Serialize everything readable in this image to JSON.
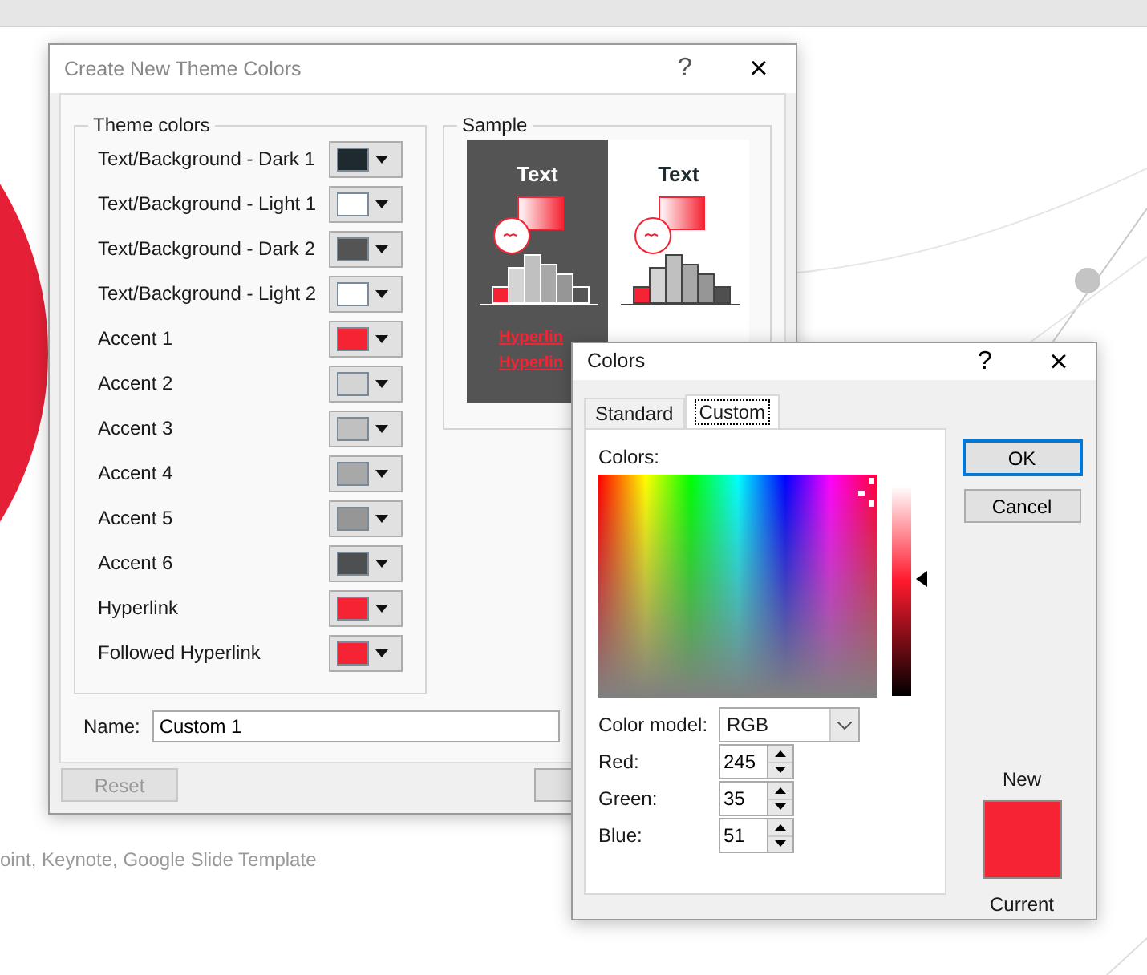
{
  "slide": {
    "subtitle": "oint, Keynote, Google Slide Template"
  },
  "theme_dialog": {
    "title": "Create New Theme Colors",
    "help": "?",
    "close": "×",
    "theme_colors": {
      "legend": "Theme colors",
      "rows": [
        {
          "label": "Text/Background - Dark 1",
          "color": "#1e2a2e"
        },
        {
          "label": "Text/Background - Light 1",
          "color": "#ffffff"
        },
        {
          "label": "Text/Background - Dark 2",
          "color": "#545454"
        },
        {
          "label": "Text/Background - Light 2",
          "color": "#ffffff"
        },
        {
          "label": "Accent 1",
          "color": "#f52333"
        },
        {
          "label": "Accent 2",
          "color": "#d4d4d4"
        },
        {
          "label": "Accent 3",
          "color": "#c0c0c0"
        },
        {
          "label": "Accent 4",
          "color": "#a8a8a8"
        },
        {
          "label": "Accent 5",
          "color": "#969696"
        },
        {
          "label": "Accent 6",
          "color": "#4d4f50"
        },
        {
          "label": "Hyperlink",
          "color": "#f52333"
        },
        {
          "label": "Followed Hyperlink",
          "color": "#f52333"
        }
      ]
    },
    "sample": {
      "legend": "Sample",
      "dark": {
        "heading": "Text",
        "links": [
          "Hyperlin",
          "Hyperlin"
        ]
      },
      "light": {
        "heading": "Text"
      }
    },
    "name_label": "Name:",
    "name_value": "Custom 1",
    "reset_button": {
      "label": "Reset",
      "disabled": true
    }
  },
  "colors_dialog": {
    "title": "Colors",
    "help": "?",
    "close": "×",
    "tabs": [
      {
        "label": "Standard",
        "selected": false
      },
      {
        "label": "Custom",
        "selected": true
      }
    ],
    "colors_label": "Colors:",
    "luminance": {
      "level": 0.56
    },
    "color_model_label": "Color model:",
    "color_model": "RGB",
    "channels": [
      {
        "label": "Red:",
        "value": "245"
      },
      {
        "label": "Green:",
        "value": "35"
      },
      {
        "label": "Blue:",
        "value": "51"
      }
    ],
    "ok": "OK",
    "cancel": "Cancel",
    "new_label": "New",
    "current_label": "Current"
  }
}
